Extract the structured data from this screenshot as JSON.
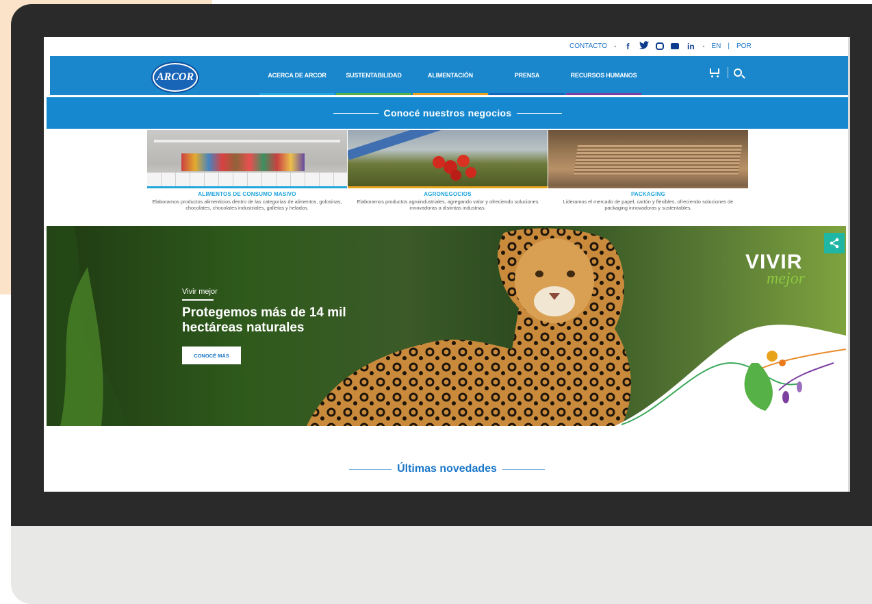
{
  "colors": {
    "nav_blue": "#1a87cc",
    "accent_blue": "#1a76c8",
    "cyan": "#20a5dd",
    "green": "#56b146",
    "orange": "#e8a31c",
    "purple": "#7b3fa0",
    "teal": "#1fb6a4"
  },
  "topbar": {
    "contacto": "CONTACTO",
    "lang_en": "EN",
    "lang_sep": "|",
    "lang_por": "POR",
    "bullet": "•",
    "social_icons": [
      "facebook-icon",
      "twitter-icon",
      "instagram-icon",
      "youtube-icon",
      "linkedin-icon"
    ],
    "facebook_glyph": "f",
    "linkedin_glyph": "in"
  },
  "nav": {
    "logo_text": "ARCOR",
    "items": [
      {
        "label": "ACERCA DE ARCOR",
        "color": "#20a5dd"
      },
      {
        "label": "SUSTENTABILIDAD",
        "color": "#56b146"
      },
      {
        "label": "ALIMENTACIÓN",
        "color": "#e8a31c"
      },
      {
        "label": "PRENSA",
        "color": "#1565b8"
      },
      {
        "label": "RECURSOS HUMANOS",
        "color": "#7b3fa0"
      }
    ]
  },
  "section": {
    "title": "Conocé nuestros negocios"
  },
  "cards": [
    {
      "title": "ALIMENTOS DE CONSUMO MASIVO",
      "desc": "Elaboramos productos alimenticios dentro de las categorías de alimentos, golosinas, chocolates, chocolates industriales, galletas y helados.",
      "color": "#20a5dd"
    },
    {
      "title": "AGRONEGOCIOS",
      "desc": "Elaboramos productos agroindustriales, agregando valor y ofreciendo soluciones innovadoras a distintas industrias.",
      "color": "#e8a31c"
    },
    {
      "title": "PACKAGING",
      "desc": "Lideramos el mercado de papel, cartón y flexibles, ofreciendo soluciones de packaging innovadoras y sustentables.",
      "color": "#8a6a4a"
    }
  ],
  "hero": {
    "kicker": "Vivir mejor",
    "headline": "Protegemos más de 14 mil hectáreas naturales",
    "cta": "CONOCÉ MÁS",
    "brand_word": "VIVIR",
    "brand_script": "mejor"
  },
  "news": {
    "title": "Últimas novedades"
  }
}
